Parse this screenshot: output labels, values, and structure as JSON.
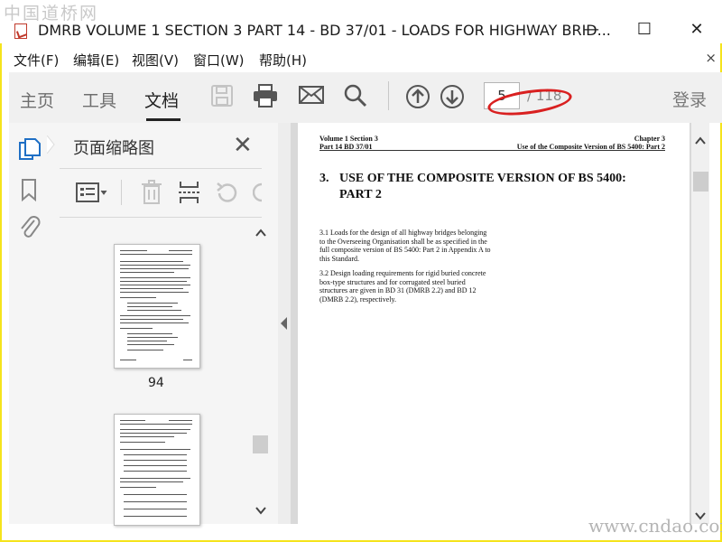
{
  "watermark_top": "中国道桥网",
  "watermark_bottom": "www.cndao.com",
  "window": {
    "title": "DMRB VOLUME 1 SECTION 3 PART 14 - BD 37/01 - LOADS FOR HIGHWAY BRID...",
    "minimize": "—",
    "maximize": "☐",
    "close": "✕"
  },
  "menu": [
    "文件(F)",
    "编辑(E)",
    "视图(V)",
    "窗口(W)",
    "帮助(H)"
  ],
  "menu_close": "×",
  "toolbar": {
    "tabs": [
      "主页",
      "工具",
      "文档"
    ],
    "active_tab": "文档",
    "page_current": "5",
    "page_total": "/ 118",
    "login": "登录"
  },
  "panel": {
    "title": "页面缩略图",
    "close": "✕",
    "thumb_label": "94"
  },
  "document": {
    "header_left_1": "Volume 1  Section 3",
    "header_left_2": "Part 14  BD 37/01",
    "header_right_1": "Chapter 3",
    "header_right_2": "Use of the Composite Version of BS 5400: Part 2",
    "heading_num": "3.",
    "heading_line1": "USE OF THE COMPOSITE VERSION OF BS 5400:",
    "heading_line2": "PART 2",
    "para1": "3.1      Loads for the design of all highway bridges belonging to the Overseeing Organisation shall be as specified in the full composite version of BS 5400: Part 2 in Appendix A to this Standard.",
    "para2": "3.2      Design loading requirements for rigid buried concrete box-type structures and for corrugated steel buried structures are given in BD 31 (DMRB 2.2) and BD 12 (DMRB 2.2), respectively."
  },
  "colors": {
    "accent_blue": "#1f6fc5",
    "annotation_red": "#d92020",
    "frame_yellow": "#f5e41c"
  }
}
